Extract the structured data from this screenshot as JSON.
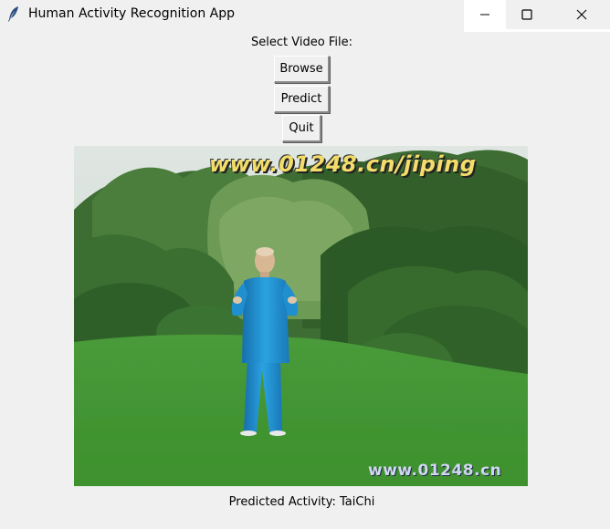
{
  "window": {
    "title": "Human Activity Recognition App",
    "icon": "feather-icon",
    "controls": [
      "minimize-icon",
      "maximize-icon",
      "close-icon"
    ]
  },
  "form": {
    "select_label": "Select Video File:",
    "browse_label": "Browse",
    "predict_label": "Predict",
    "quit_label": "Quit"
  },
  "video": {
    "watermark_top": "www.01248.cn/jiping",
    "watermark_bottom": "www.01248.cn"
  },
  "result": {
    "text": "Predicted Activity: TaiChi"
  },
  "colors": {
    "window_bg": "#f0f0f0",
    "grass": "#3f9a33",
    "trees": "#2f5e26",
    "figure_suit": "#1f8fd0",
    "watermark_top": "#f2dd6a"
  }
}
